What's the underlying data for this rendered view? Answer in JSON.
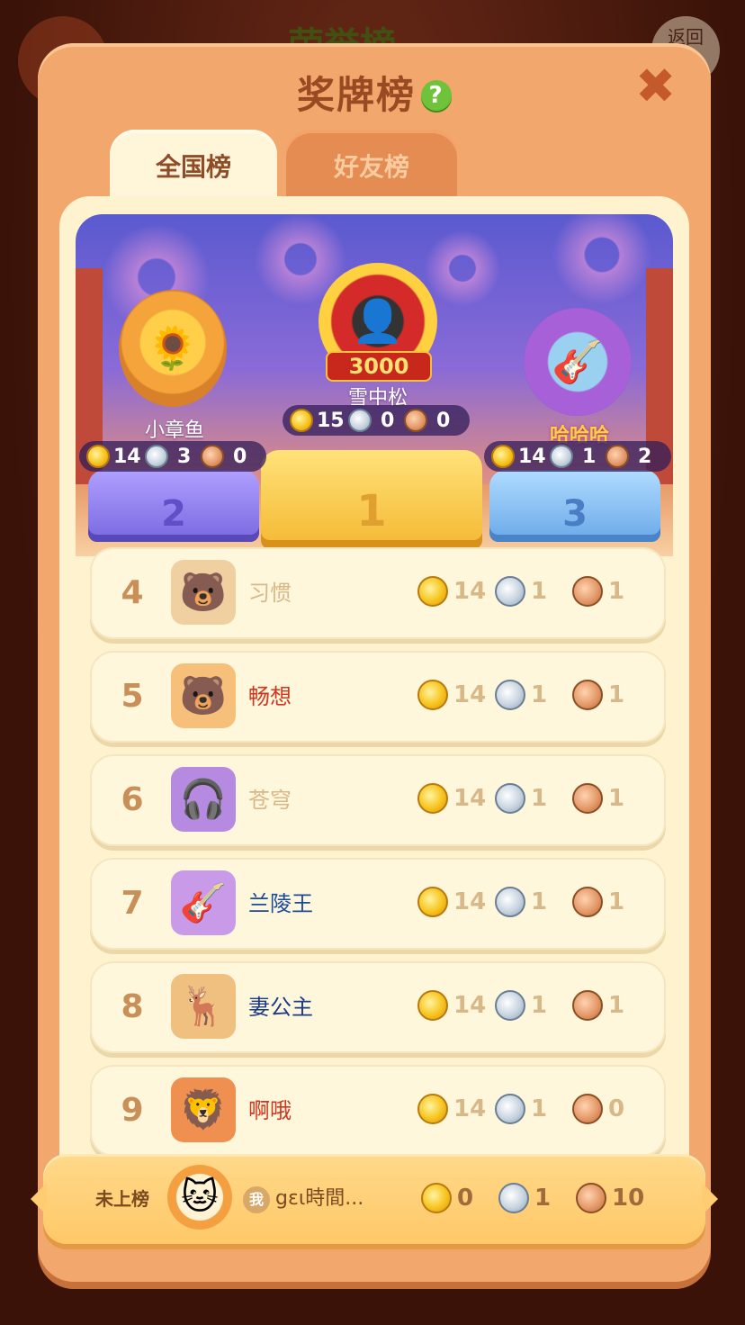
{
  "background": {
    "title": "荣誉榜",
    "back_label": "返回"
  },
  "modal": {
    "title": "奖牌榜",
    "help_icon": "?",
    "close_icon": "✖"
  },
  "tabs": [
    {
      "label": "全国榜",
      "active": true
    },
    {
      "label": "好友榜",
      "active": false
    }
  ],
  "podium": {
    "first": {
      "name": "雪中松",
      "badge": "3000",
      "gold": "15",
      "silver": "0",
      "bronze": "0",
      "rank": "1"
    },
    "second": {
      "name": "小章鱼",
      "gold": "14",
      "silver": "3",
      "bronze": "0",
      "rank": "2"
    },
    "third": {
      "name": "哈哈哈",
      "gold": "14",
      "silver": "1",
      "bronze": "2",
      "rank": "3"
    }
  },
  "rows": [
    {
      "rank": "4",
      "name": "习惯",
      "name_color": "#d8b888",
      "gold": "14",
      "silver": "1",
      "bronze": "1",
      "avatar_icon": "🐻",
      "avatar_bg": "#f0d0a0"
    },
    {
      "rank": "5",
      "name": "畅想",
      "name_color": "#d0361e",
      "gold": "14",
      "silver": "1",
      "bronze": "1",
      "avatar_icon": "🐻",
      "avatar_bg": "#f7c07a"
    },
    {
      "rank": "6",
      "name": "苍穹",
      "name_color": "#d8b888",
      "gold": "14",
      "silver": "1",
      "bronze": "1",
      "avatar_icon": "🎧",
      "avatar_bg": "#b58ae0"
    },
    {
      "rank": "7",
      "name": "兰陵王",
      "name_color": "#1a4a9a",
      "gold": "14",
      "silver": "1",
      "bronze": "1",
      "avatar_icon": "🎸",
      "avatar_bg": "#c89ae8"
    },
    {
      "rank": "8",
      "name": "妻公主",
      "name_color": "#1a3a8a",
      "gold": "14",
      "silver": "1",
      "bronze": "1",
      "avatar_icon": "🦌",
      "avatar_bg": "#f0c080"
    },
    {
      "rank": "9",
      "name": "啊哦",
      "name_color": "#d0361e",
      "gold": "14",
      "silver": "1",
      "bronze": "0",
      "avatar_icon": "🦁",
      "avatar_bg": "#f09050"
    }
  ],
  "me": {
    "rank_label": "未上榜",
    "tag": "我",
    "name": "gɛι時間...",
    "gold": "0",
    "silver": "1",
    "bronze": "10",
    "avatar_icon": "🐱"
  },
  "colors": {
    "panel": "#f2a86c",
    "content": "#fff3cf",
    "title": "#9a4a22",
    "gold": "#f7c41e",
    "silver": "#c8d4e0",
    "bronze": "#e49a6a"
  }
}
